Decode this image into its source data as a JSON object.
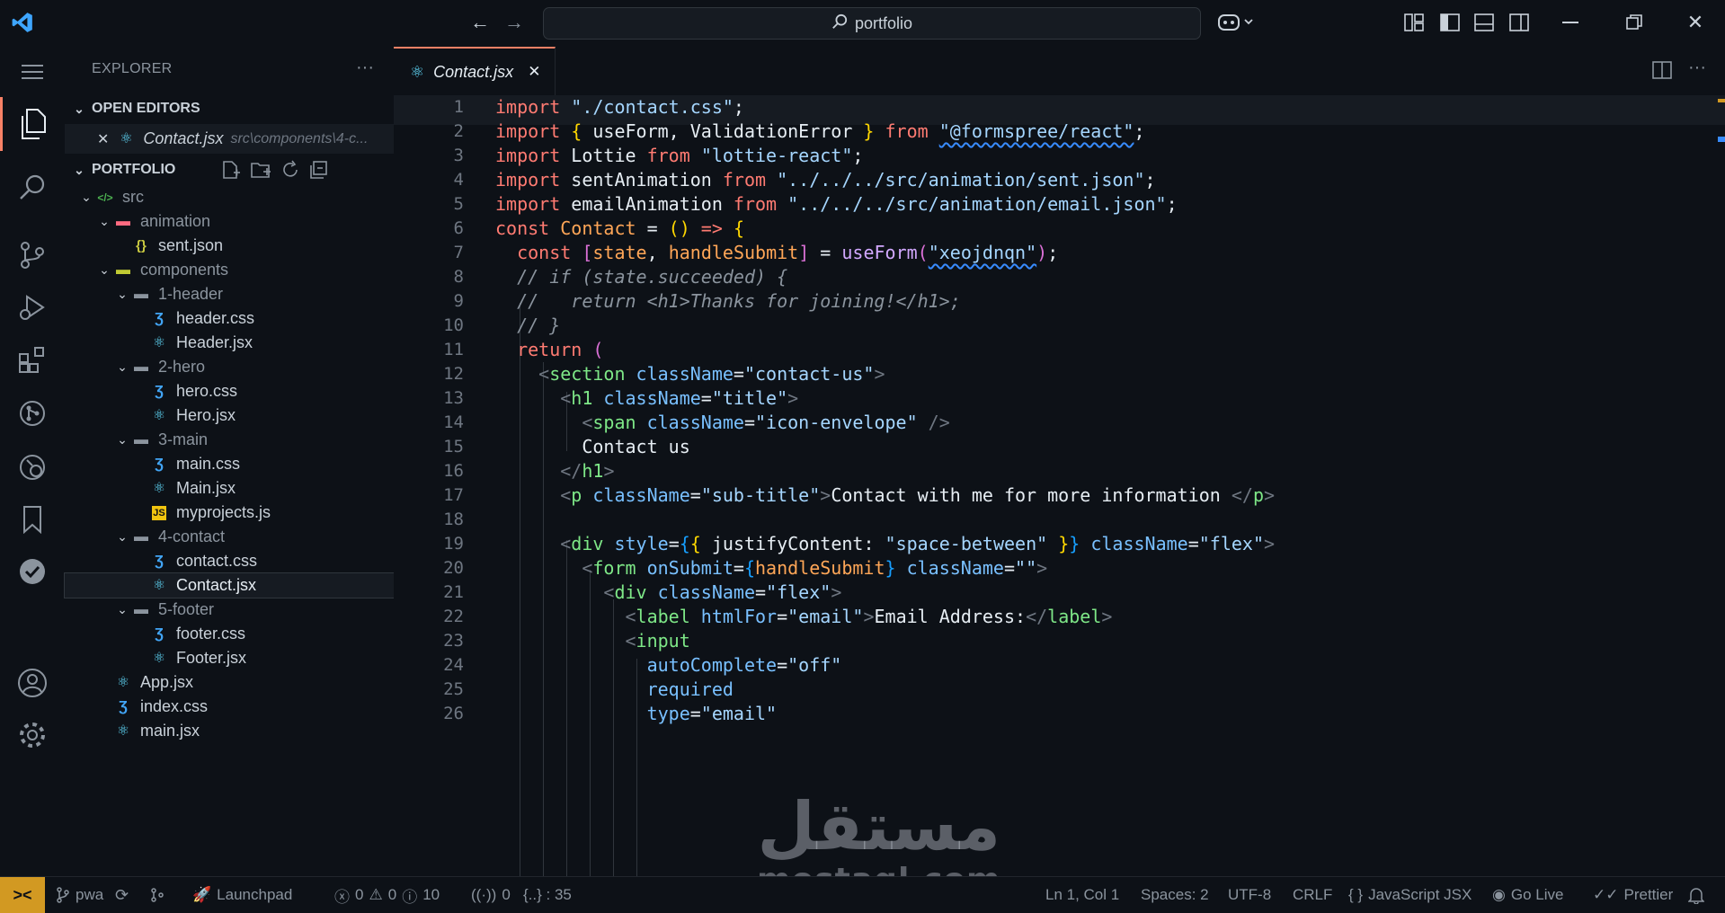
{
  "titlebar": {
    "search_text": "portfolio",
    "icons": [
      "vscode-logo-icon",
      "back-arrow-icon",
      "forward-arrow-icon",
      "copilot-icon",
      "layout-icon",
      "toggle-sidebar-icon",
      "toggle-panel-icon",
      "toggle-secondary-sidebar-icon",
      "minimize-icon",
      "restore-icon",
      "close-icon"
    ]
  },
  "activitybar": {
    "items": [
      "menu-icon",
      "explorer-icon",
      "search-icon",
      "source-control-icon",
      "run-debug-icon",
      "extensions-icon",
      "git-graph-icon",
      "remote-explorer-icon",
      "bookmark-icon",
      "check-icon",
      "accounts-icon",
      "settings-gear-icon"
    ]
  },
  "sidebar": {
    "title": "EXPLORER",
    "more": "···",
    "open_editors_label": "OPEN EDITORS",
    "open_editor": {
      "name": "Contact.jsx",
      "path": "src\\components\\4-c..."
    },
    "project_label": "PORTFOLIO",
    "tree": [
      {
        "name": "src",
        "kind": "folder-src",
        "depth": 0,
        "open": true
      },
      {
        "name": "animation",
        "kind": "folder-animation",
        "depth": 1,
        "open": true
      },
      {
        "name": "sent.json",
        "kind": "json",
        "depth": 2
      },
      {
        "name": "components",
        "kind": "folder-components",
        "depth": 1,
        "open": true
      },
      {
        "name": "1-header",
        "kind": "folder",
        "depth": 2,
        "open": true
      },
      {
        "name": "header.css",
        "kind": "css",
        "depth": 3
      },
      {
        "name": "Header.jsx",
        "kind": "react",
        "depth": 3
      },
      {
        "name": "2-hero",
        "kind": "folder",
        "depth": 2,
        "open": true
      },
      {
        "name": "hero.css",
        "kind": "css",
        "depth": 3
      },
      {
        "name": "Hero.jsx",
        "kind": "react",
        "depth": 3
      },
      {
        "name": "3-main",
        "kind": "folder",
        "depth": 2,
        "open": true
      },
      {
        "name": "main.css",
        "kind": "css",
        "depth": 3
      },
      {
        "name": "Main.jsx",
        "kind": "react",
        "depth": 3
      },
      {
        "name": "myprojects.js",
        "kind": "js",
        "depth": 3
      },
      {
        "name": "4-contact",
        "kind": "folder",
        "depth": 2,
        "open": true
      },
      {
        "name": "contact.css",
        "kind": "css",
        "depth": 3
      },
      {
        "name": "Contact.jsx",
        "kind": "react",
        "depth": 3,
        "selected": true
      },
      {
        "name": "5-footer",
        "kind": "folder",
        "depth": 2,
        "open": true
      },
      {
        "name": "footer.css",
        "kind": "css",
        "depth": 3
      },
      {
        "name": "Footer.jsx",
        "kind": "react",
        "depth": 3
      },
      {
        "name": "App.jsx",
        "kind": "react",
        "depth": 1
      },
      {
        "name": "index.css",
        "kind": "css",
        "depth": 1
      },
      {
        "name": "main.jsx",
        "kind": "react",
        "depth": 1
      }
    ]
  },
  "tab": {
    "name": "Contact.jsx",
    "close": "✕"
  },
  "editor": {
    "lines": [
      [
        [
          "k",
          "import "
        ],
        [
          "s",
          "\"./contact.css\""
        ],
        [
          "p",
          ";"
        ]
      ],
      [
        [
          "k",
          "import "
        ],
        [
          "br1",
          "{ "
        ],
        [
          "p",
          "useForm, ValidationError "
        ],
        [
          "br1",
          "}"
        ],
        [
          "k",
          " from "
        ],
        [
          "s",
          "\"@formspree/react\""
        ],
        [
          "p",
          ";"
        ]
      ],
      [
        [
          "k",
          "import "
        ],
        [
          "p",
          "Lottie "
        ],
        [
          "k",
          "from "
        ],
        [
          "s",
          "\"lottie-react\""
        ],
        [
          "p",
          ";"
        ]
      ],
      [
        [
          "k",
          "import "
        ],
        [
          "p",
          "sentAnimation "
        ],
        [
          "k",
          "from "
        ],
        [
          "s",
          "\"../../../src/animation/sent.json\""
        ],
        [
          "p",
          ";"
        ]
      ],
      [
        [
          "k",
          "import "
        ],
        [
          "p",
          "emailAnimation "
        ],
        [
          "k",
          "from "
        ],
        [
          "s",
          "\"../../../src/animation/email.json\""
        ],
        [
          "p",
          ";"
        ]
      ],
      [
        [
          "k",
          "const "
        ],
        [
          "v",
          "Contact"
        ],
        [
          "p",
          " = "
        ],
        [
          "br1",
          "()"
        ],
        [
          "k",
          " => "
        ],
        [
          "br1",
          "{"
        ]
      ],
      [
        [
          "p",
          "  "
        ],
        [
          "k",
          "const "
        ],
        [
          "br2",
          "["
        ],
        [
          "v",
          "state"
        ],
        [
          "p",
          ", "
        ],
        [
          "v",
          "handleSubmit"
        ],
        [
          "br2",
          "]"
        ],
        [
          "p",
          " = "
        ],
        [
          "f",
          "useForm"
        ],
        [
          "br2",
          "("
        ],
        [
          "s",
          "\"xeojdnqn\""
        ],
        [
          "br2",
          ")"
        ],
        [
          "p",
          ";"
        ]
      ],
      [
        [
          "c",
          "  // if (state.succeeded) {"
        ]
      ],
      [
        [
          "c",
          "  //   return <h1>Thanks for joining!</h1>;"
        ]
      ],
      [
        [
          "c",
          "  // }"
        ]
      ],
      [
        [
          "p",
          "  "
        ],
        [
          "k",
          "return "
        ],
        [
          "br2",
          "("
        ]
      ],
      [
        [
          "p",
          "    "
        ],
        [
          "tagp",
          "<"
        ],
        [
          "t",
          "section "
        ],
        [
          "a",
          "className"
        ],
        [
          "p",
          "="
        ],
        [
          "s",
          "\"contact-us\""
        ],
        [
          "tagp",
          ">"
        ]
      ],
      [
        [
          "p",
          "      "
        ],
        [
          "tagp",
          "<"
        ],
        [
          "t",
          "h1 "
        ],
        [
          "a",
          "className"
        ],
        [
          "p",
          "="
        ],
        [
          "s",
          "\"title\""
        ],
        [
          "tagp",
          ">"
        ]
      ],
      [
        [
          "p",
          "        "
        ],
        [
          "tagp",
          "<"
        ],
        [
          "t",
          "span "
        ],
        [
          "a",
          "className"
        ],
        [
          "p",
          "="
        ],
        [
          "s",
          "\"icon-envelope\""
        ],
        [
          "tagp",
          " />"
        ]
      ],
      [
        [
          "p",
          "        Contact us"
        ]
      ],
      [
        [
          "p",
          "      "
        ],
        [
          "tagp",
          "</"
        ],
        [
          "t",
          "h1"
        ],
        [
          "tagp",
          ">"
        ]
      ],
      [
        [
          "p",
          "      "
        ],
        [
          "tagp",
          "<"
        ],
        [
          "t",
          "p "
        ],
        [
          "a",
          "className"
        ],
        [
          "p",
          "="
        ],
        [
          "s",
          "\"sub-title\""
        ],
        [
          "tagp",
          ">"
        ],
        [
          "p",
          "Contact with me for more information "
        ],
        [
          "tagp",
          "</"
        ],
        [
          "t",
          "p"
        ],
        [
          "tagp",
          ">"
        ]
      ],
      [
        [
          "p",
          ""
        ]
      ],
      [
        [
          "p",
          "      "
        ],
        [
          "tagp",
          "<"
        ],
        [
          "t",
          "div "
        ],
        [
          "a",
          "style"
        ],
        [
          "p",
          "="
        ],
        [
          "br3",
          "{"
        ],
        [
          "br1",
          "{ "
        ],
        [
          "p",
          "justifyContent: "
        ],
        [
          "s",
          "\"space-between\""
        ],
        [
          "br1",
          " }"
        ],
        [
          "br3",
          "}"
        ],
        [
          "a",
          " className"
        ],
        [
          "p",
          "="
        ],
        [
          "s",
          "\"flex\""
        ],
        [
          "tagp",
          ">"
        ]
      ],
      [
        [
          "p",
          "        "
        ],
        [
          "tagp",
          "<"
        ],
        [
          "t",
          "form "
        ],
        [
          "a",
          "onSubmit"
        ],
        [
          "p",
          "="
        ],
        [
          "br3",
          "{"
        ],
        [
          "v",
          "handleSubmit"
        ],
        [
          "br3",
          "}"
        ],
        [
          "a",
          " className"
        ],
        [
          "p",
          "="
        ],
        [
          "s",
          "\"\""
        ],
        [
          "tagp",
          ">"
        ]
      ],
      [
        [
          "p",
          "          "
        ],
        [
          "tagp",
          "<"
        ],
        [
          "t",
          "div "
        ],
        [
          "a",
          "className"
        ],
        [
          "p",
          "="
        ],
        [
          "s",
          "\"flex\""
        ],
        [
          "tagp",
          ">"
        ]
      ],
      [
        [
          "p",
          "            "
        ],
        [
          "tagp",
          "<"
        ],
        [
          "t",
          "label "
        ],
        [
          "a",
          "htmlFor"
        ],
        [
          "p",
          "="
        ],
        [
          "s",
          "\"email\""
        ],
        [
          "tagp",
          ">"
        ],
        [
          "p",
          "Email Address:"
        ],
        [
          "tagp",
          "</"
        ],
        [
          "t",
          "label"
        ],
        [
          "tagp",
          ">"
        ]
      ],
      [
        [
          "p",
          "            "
        ],
        [
          "tagp",
          "<"
        ],
        [
          "t",
          "input"
        ]
      ],
      [
        [
          "p",
          "              "
        ],
        [
          "a",
          "autoComplete"
        ],
        [
          "p",
          "="
        ],
        [
          "s",
          "\"off\""
        ]
      ],
      [
        [
          "p",
          "              "
        ],
        [
          "a",
          "required"
        ]
      ],
      [
        [
          "p",
          "              "
        ],
        [
          "a",
          "type"
        ],
        [
          "p",
          "="
        ],
        [
          "s",
          "\"email\""
        ]
      ]
    ]
  },
  "statusbar": {
    "remote": "><",
    "branch": "pwa",
    "launchpad": "Launchpad",
    "errors": "0",
    "warnings": "0",
    "info": "10",
    "ports": "0",
    "symbol": "{..} : 35",
    "cursor": "Ln 1, Col 1",
    "spaces": "Spaces: 2",
    "encoding": "UTF-8",
    "eol": "CRLF",
    "language": "JavaScript JSX",
    "golive": "Go Live",
    "prettier": "Prettier"
  },
  "watermark": {
    "arabic": "مستقل",
    "latin": "mostaql.com"
  },
  "colors": {
    "accent": "#f78166",
    "remote_bg": "#d29922",
    "react": "#61dafb",
    "css": "#42a5f5"
  }
}
